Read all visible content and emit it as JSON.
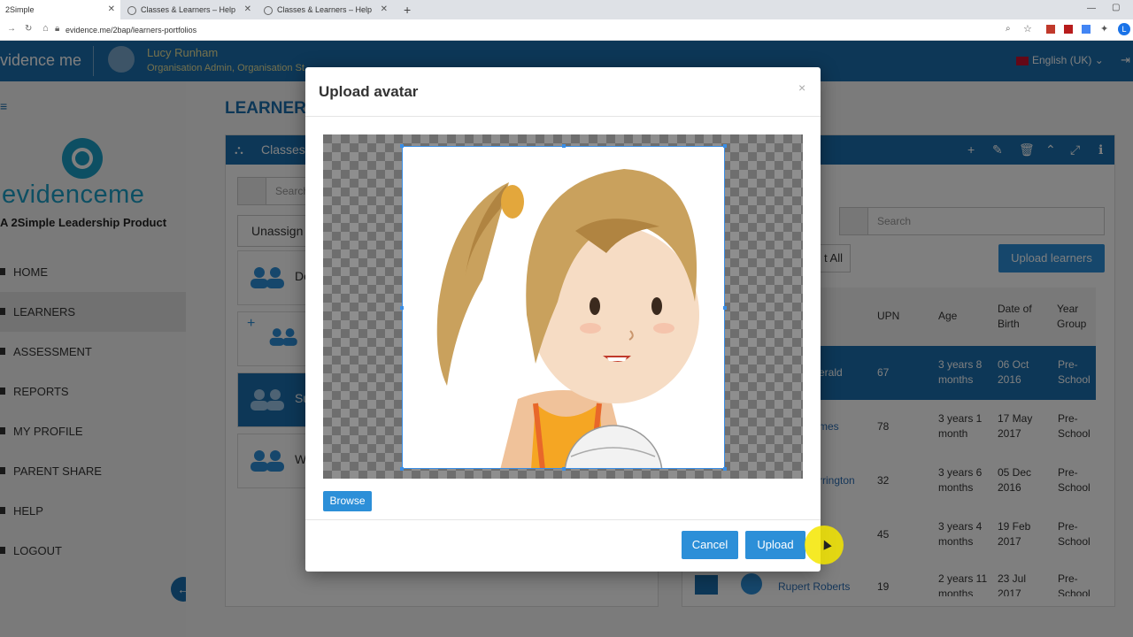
{
  "browser": {
    "tabs": [
      {
        "title": "2Simple"
      },
      {
        "title": "Classes & Learners – Help Centre"
      },
      {
        "title": "Classes & Learners – Help Centre"
      }
    ],
    "url": "evidence.me/2bap/learners-portfolios"
  },
  "header": {
    "brand": "vidence me",
    "user_name": "Lucy Runham",
    "user_role": "Organisation Admin, Organisation St...",
    "language": "English (UK)"
  },
  "sidebar": {
    "logo_text": "evidenceme",
    "logo_sub": "A 2Simple Leadership Product",
    "items": [
      {
        "label": "HOME"
      },
      {
        "label": "LEARNERS"
      },
      {
        "label": "ASSESSMENT"
      },
      {
        "label": "REPORTS"
      },
      {
        "label": "MY PROFILE"
      },
      {
        "label": "PARENT SHARE"
      },
      {
        "label": "HELP"
      },
      {
        "label": "LOGOUT"
      }
    ]
  },
  "main": {
    "page_title": "LEARNERS",
    "left_panel": {
      "head": "Classes",
      "search_placeholder": "Search",
      "filter": "Unassign",
      "groups": [
        "De",
        "",
        "Su",
        "W"
      ]
    },
    "right_panel": {
      "search_placeholder": "Search",
      "select_all": "t All",
      "upload_button": "Upload learners",
      "columns": [
        "UPN",
        "Age",
        "Date of Birth",
        "Year Group"
      ],
      "rows": [
        {
          "name": "erald",
          "upn": "67",
          "age": "3 years 8 months",
          "dob": "06 Oct 2016",
          "year": "Pre-School"
        },
        {
          "name": "mes",
          "upn": "78",
          "age": "3 years 1 month",
          "dob": "17 May 2017",
          "year": "Pre-School"
        },
        {
          "name": "rrington",
          "upn": "32",
          "age": "3 years 6 months",
          "dob": "05 Dec 2016",
          "year": "Pre-School"
        },
        {
          "name": "",
          "upn": "45",
          "age": "3 years 4 months",
          "dob": "19 Feb 2017",
          "year": "Pre-School"
        },
        {
          "name": "Rupert Roberts",
          "upn": "19",
          "age": "2 years 11 months",
          "dob": "23 Jul 2017",
          "year": "Pre-School"
        }
      ]
    }
  },
  "modal": {
    "title": "Upload avatar",
    "browse_label": "Browse",
    "cancel_label": "Cancel",
    "upload_label": "Upload"
  },
  "colors": {
    "brand_blue": "#1b6fae",
    "button_blue": "#2c8fd8",
    "logo_teal": "#1a9ec6"
  }
}
